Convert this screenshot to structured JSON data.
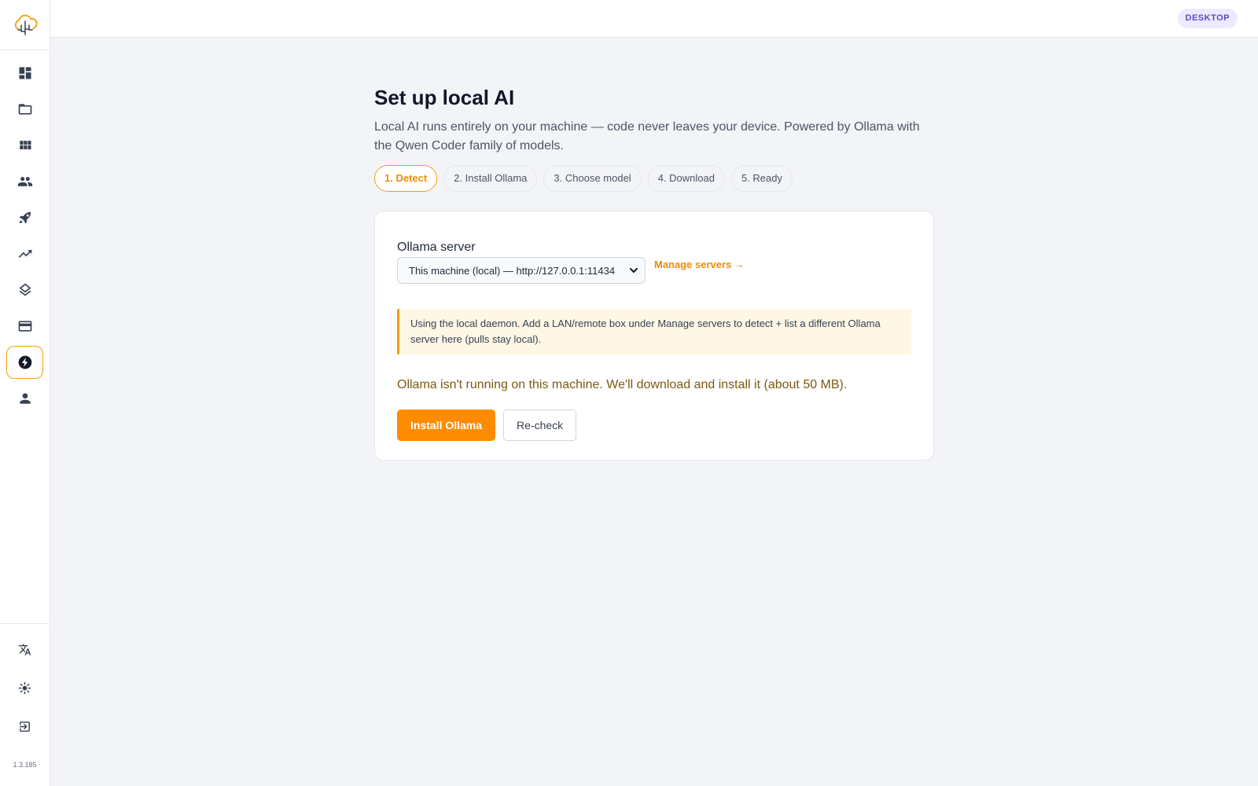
{
  "app": {
    "version": "1.3.185",
    "mode_badge": "DESKTOP",
    "accent": "#ff8c00"
  },
  "sidebar": {
    "logo_icon": "cloud-logo-icon",
    "items": [
      {
        "icon": "dashboard-icon",
        "active": false
      },
      {
        "icon": "folder-icon",
        "active": false
      },
      {
        "icon": "apps-grid-icon",
        "active": false
      },
      {
        "icon": "people-icon",
        "active": false
      },
      {
        "icon": "rocket-icon",
        "active": false
      },
      {
        "icon": "trending-up-icon",
        "active": false
      },
      {
        "icon": "layers-icon",
        "active": false
      },
      {
        "icon": "credit-card-icon",
        "active": false
      },
      {
        "icon": "bolt-icon",
        "active": true
      },
      {
        "icon": "person-icon",
        "active": false
      }
    ],
    "bottom": [
      {
        "icon": "translate-icon"
      },
      {
        "icon": "sun-icon"
      },
      {
        "icon": "logout-icon"
      }
    ]
  },
  "page": {
    "title": "Set up local AI",
    "subtitle": "Local AI runs entirely on your machine — code never leaves your device. Powered by Ollama with the Qwen Coder family of models.",
    "steps": [
      "1. Detect",
      "2. Install Ollama",
      "3. Choose model",
      "4. Download",
      "5. Ready"
    ],
    "active_step": 0
  },
  "card": {
    "server_label": "Ollama server",
    "server_selected": "This machine (local) — http://127.0.0.1:11434",
    "manage_link": "Manage servers →",
    "notice": "Using the local daemon. Add a LAN/remote box under Manage servers to detect + list a different Ollama server here (pulls stay local).",
    "status": "Ollama isn't running on this machine. We'll download and install it (about 50 MB).",
    "install_button": "Install Ollama",
    "recheck_button": "Re-check"
  }
}
